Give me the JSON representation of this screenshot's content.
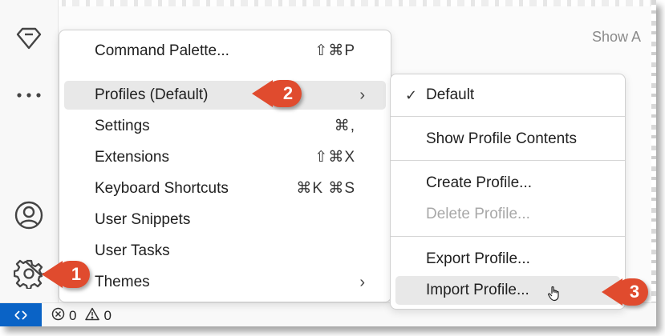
{
  "header": {
    "show_all_label": "Show A"
  },
  "activity_bar": {
    "icons": [
      "gem-icon",
      "more-icon",
      "account-icon",
      "manage-gear-icon"
    ]
  },
  "status_bar": {
    "errors_count": "0",
    "warnings_count": "0"
  },
  "menu": {
    "items": [
      {
        "label": "Command Palette...",
        "shortcut": "⇧⌘P"
      },
      {
        "label": "Profiles (Default)",
        "shortcut": ""
      },
      {
        "label": "Settings",
        "shortcut": "⌘,"
      },
      {
        "label": "Extensions",
        "shortcut": "⇧⌘X"
      },
      {
        "label": "Keyboard Shortcuts",
        "shortcut": "⌘K ⌘S"
      },
      {
        "label": "User Snippets",
        "shortcut": ""
      },
      {
        "label": "User Tasks",
        "shortcut": ""
      },
      {
        "label": "Themes",
        "shortcut": ""
      }
    ]
  },
  "profiles_submenu": {
    "items": [
      {
        "label": "Default",
        "checked": true
      },
      {
        "label": "Show Profile Contents"
      },
      {
        "label": "Create Profile..."
      },
      {
        "label": "Delete Profile...",
        "disabled": true
      },
      {
        "label": "Export Profile..."
      },
      {
        "label": "Import Profile..."
      }
    ]
  },
  "callouts": [
    "1",
    "2",
    "3"
  ],
  "colors": {
    "callout": "#e04b2e",
    "remote_button": "#0a63c6",
    "hover_bg": "#e8e8e8"
  }
}
